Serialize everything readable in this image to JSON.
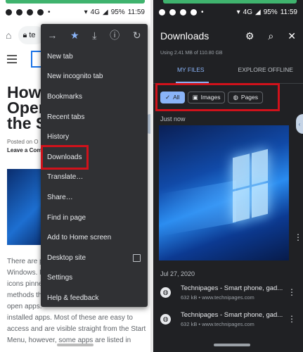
{
  "left_screen": {
    "status": {
      "time": "11:59",
      "battery": "95%",
      "signal": "4G"
    },
    "url_fragment": "te",
    "article_title": "How\nOpen\nthe S",
    "meta_line1": "Posted on O",
    "meta_line2": "Leave a Com",
    "body_text": "There are p\nWindows. F\nicons pinne\nmethods th\nopen apps.\ninstalled apps. Most of these are easy to\naccess and are visible straight from the Start\nMenu, however, some apps are listed in",
    "menu": {
      "items": [
        "New tab",
        "New incognito tab",
        "Bookmarks",
        "Recent tabs",
        "History",
        "Downloads",
        "Translate…",
        "Share…",
        "Find in page",
        "Add to Home screen",
        "Desktop site",
        "Settings",
        "Help & feedback"
      ],
      "highlighted": "Downloads"
    }
  },
  "right_screen": {
    "status": {
      "time": "11:59",
      "battery": "95%",
      "signal": "4G"
    },
    "title": "Downloads",
    "storage": "Using 2.41 MB of 110.80 GB",
    "tabs": [
      "MY FILES",
      "EXPLORE OFFLINE"
    ],
    "active_tab": "MY FILES",
    "chips": [
      "All",
      "Images",
      "Pages"
    ],
    "selected_chip": "All",
    "section_just_now": "Just now",
    "section_date": "Jul 27, 2020",
    "items": [
      {
        "title": "Technipages - Smart phone, gad...",
        "subtitle": "632 kB • www.technipages.com"
      },
      {
        "title": "Technipages - Smart phone, gad...",
        "subtitle": "632 kB • www.technipages.com"
      }
    ]
  },
  "colors": {
    "highlight_red": "#d0121b",
    "accent_blue": "#8ab4f8",
    "dark_bg": "#202124",
    "menu_bg": "#303134"
  }
}
